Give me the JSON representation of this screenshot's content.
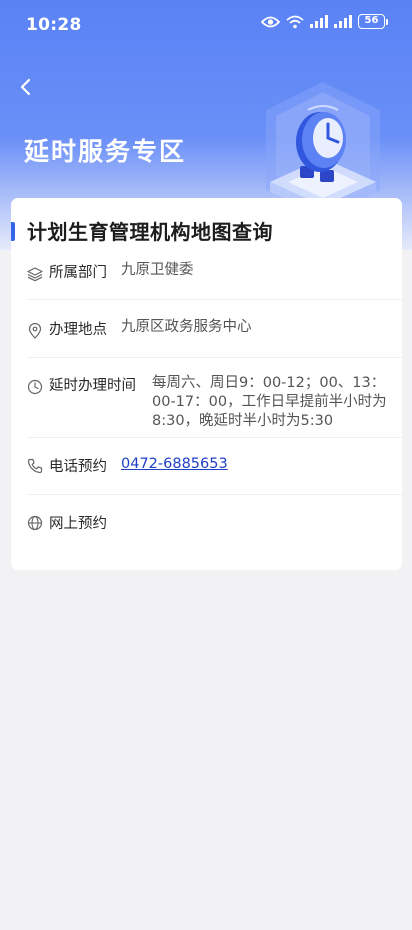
{
  "status_bar": {
    "time": "10:28",
    "battery": "56",
    "icons": [
      "eye-icon",
      "wifi-icon",
      "signal-icon",
      "signal-icon",
      "battery-icon"
    ]
  },
  "header": {
    "back_icon": "chevron-left-icon",
    "title": "延时服务专区"
  },
  "card": {
    "title": "计划生育管理机构地图查询",
    "rows": [
      {
        "icon": "layers-icon",
        "label": "所属部门",
        "value": "九原卫健委"
      },
      {
        "icon": "location-pin-icon",
        "label": "办理地点",
        "value": "九原区政务服务中心"
      },
      {
        "icon": "clock-icon",
        "label": "延时办理时间",
        "value": "每周六、周日9：00-12；00、13：00-17：00，工作日早提前半小时为8:30，晚延时半小时为5:30"
      },
      {
        "icon": "phone-icon",
        "label": "电话预约",
        "value": "0472-6885653"
      },
      {
        "icon": "globe-icon",
        "label": "网上预约",
        "value": ""
      }
    ]
  },
  "colors": {
    "accent": "#3566e8",
    "hero_top": "#5a82f5",
    "link": "#1f3fc7",
    "background": "#f2f2f4"
  }
}
